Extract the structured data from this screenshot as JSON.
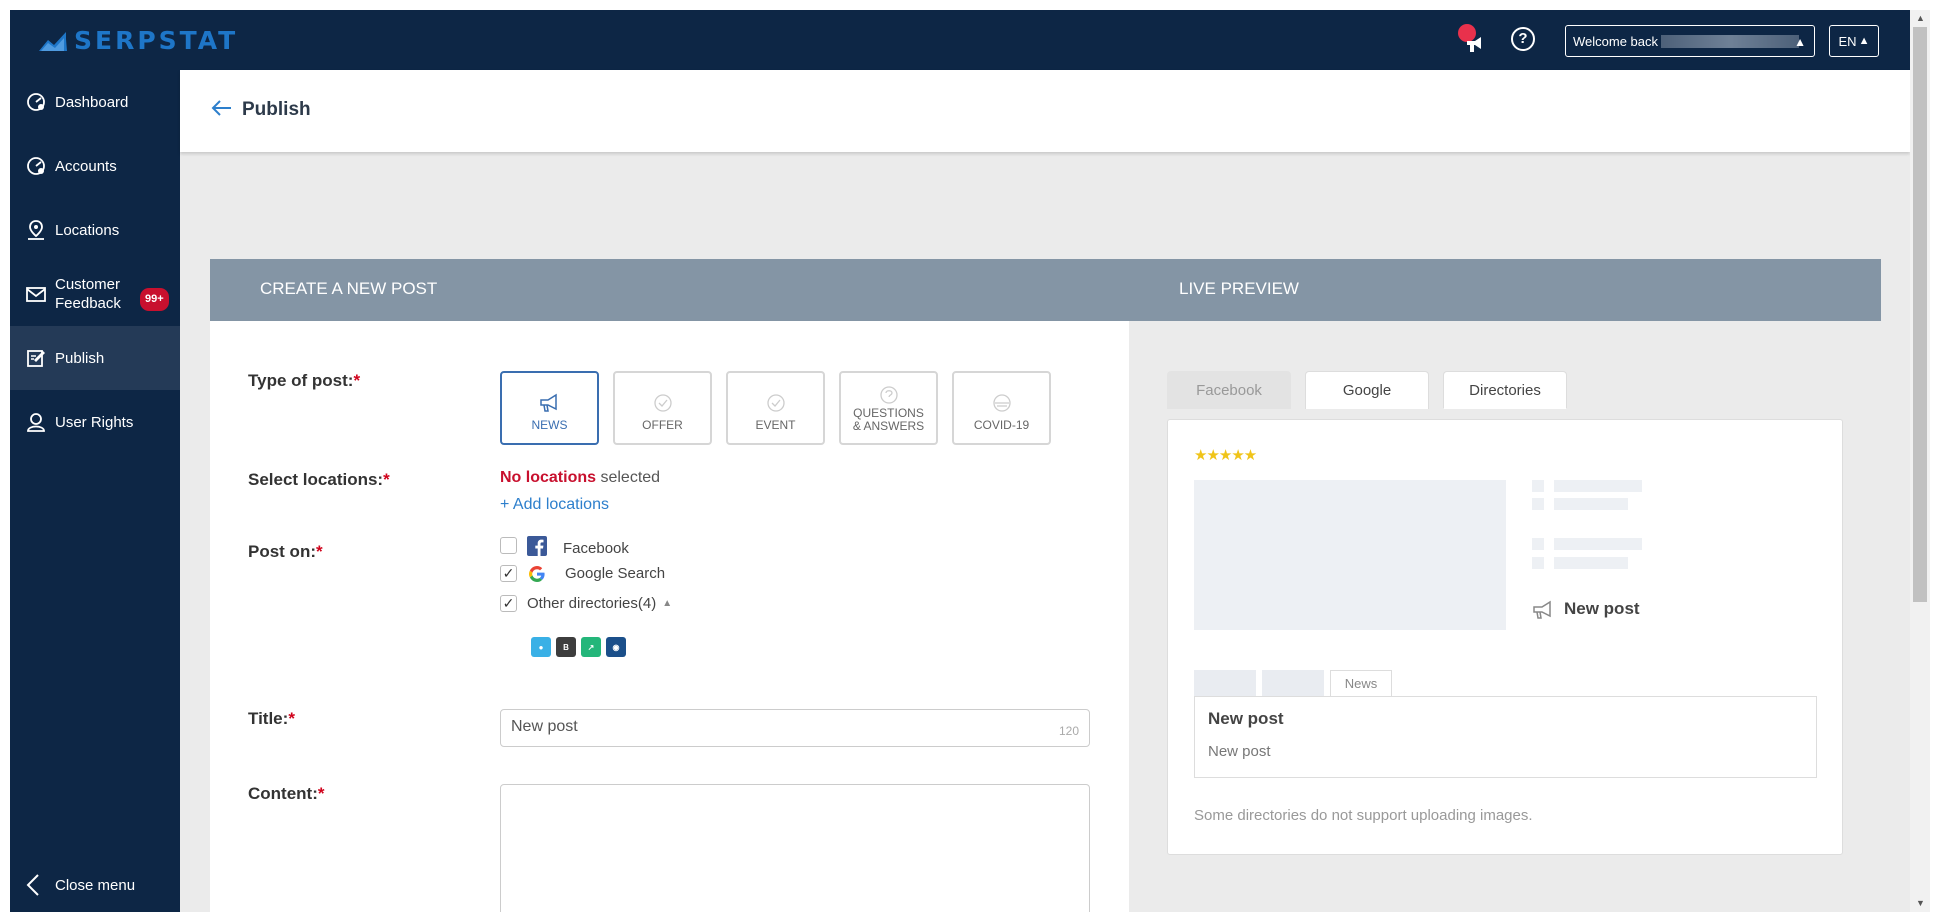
{
  "app": {
    "logo_text": "SERPSTAT",
    "brand_color": "#1e76c8",
    "nav_bg": "#0d2645"
  },
  "topbar": {
    "welcome": "Welcome back",
    "lang": "EN",
    "help": "?"
  },
  "sidebar": {
    "items": [
      {
        "label": "Dashboard",
        "icon": "dashboard-icon"
      },
      {
        "label": "Accounts",
        "icon": "accounts-icon"
      },
      {
        "label": "Locations",
        "icon": "location-pin-icon"
      },
      {
        "label": "Customer Feedback",
        "icon": "envelope-icon",
        "badge": "99+"
      },
      {
        "label": "Publish",
        "icon": "edit-icon",
        "active": true
      },
      {
        "label": "User Rights",
        "icon": "user-icon"
      }
    ],
    "close": "Close menu"
  },
  "header": {
    "title": "Publish"
  },
  "panel": {
    "create_title": "CREATE A NEW POST",
    "preview_title": "LIVE PREVIEW"
  },
  "form": {
    "type_label": "Type of post:",
    "types": [
      "NEWS",
      "OFFER",
      "EVENT",
      "QUESTIONS & ANSWERS",
      "COVID-19"
    ],
    "selected_type": "NEWS",
    "locations_label": "Select locations:",
    "no_locations": "No locations",
    "selected_word": "selected",
    "add_locations": "+ Add locations",
    "post_on_label": "Post on:",
    "post_on": [
      {
        "label": "Facebook",
        "checked": false
      },
      {
        "label": "Google Search",
        "checked": true
      },
      {
        "label": "Other directories(4)",
        "checked": true
      }
    ],
    "title_label": "Title:",
    "title_value": "New post",
    "title_counter": "120",
    "content_label": "Content:",
    "required_mark": "*"
  },
  "preview": {
    "tabs": [
      "Facebook",
      "Google",
      "Directories"
    ],
    "active_tab": "Directories",
    "stars": "★★★★★",
    "post_title": "New post",
    "news_tab": "News",
    "box_title": "New post",
    "box_content": "New post",
    "note": "Some directories do not support uploading images."
  }
}
